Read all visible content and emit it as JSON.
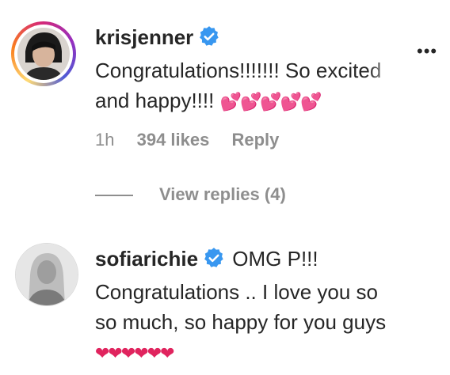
{
  "comments": [
    {
      "username": "krisjenner",
      "text_line1": "Congratulations!!!!!!! So excited",
      "text_line2": "and happy!!!! ",
      "emoji": "💕💕💕💕💕",
      "time": "1h",
      "likes": "394 likes",
      "reply": "Reply",
      "view_replies": "View replies (4)"
    },
    {
      "username": "sofiarichie",
      "text_line1": " OMG P!!!",
      "text_line2": "Congratulations .. I love you so",
      "text_line3": "so much, so happy for you guys",
      "emoji": "❤❤❤❤❤❤"
    }
  ],
  "more_icon": "•••",
  "colors": {
    "verified": "#3897f0",
    "muted": "#8e8e8e",
    "text": "#262626"
  }
}
